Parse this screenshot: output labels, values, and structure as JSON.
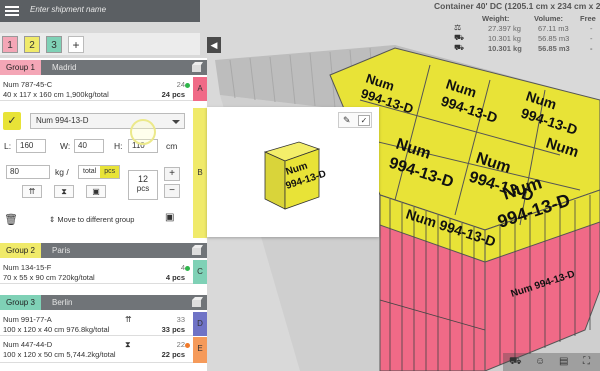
{
  "search": {
    "placeholder": "Enter shipment name"
  },
  "group_tabs": [
    "1",
    "2",
    "3"
  ],
  "add_tab": "+",
  "groups": [
    {
      "name": "Group 1",
      "city": "Madrid",
      "color": "#f4a6b6",
      "items": [
        {
          "num": "Num 787-45-C",
          "dims": "40 x 117 x 160 cm 1,900kg/total",
          "count": "24",
          "pcs": "24 pcs",
          "letter": "A",
          "letter_color": "#f06a87"
        }
      ]
    },
    {
      "name": "Group 2",
      "city": "Paris",
      "color": "#f0ea6a",
      "items": [
        {
          "num": "Num 134-15-F",
          "dims": "70 x 55 x 90 cm 720kg/total",
          "count": "4",
          "pcs": "4 pcs",
          "letter": "C",
          "letter_color": "#7fd1b6"
        }
      ]
    },
    {
      "name": "Group 3",
      "city": "Berlin",
      "color": "#7fd1b6",
      "items": [
        {
          "num": "Num 991-77-A",
          "dims": "100 x 120 x 40 cm 976.8kg/total",
          "count": "33",
          "pcs": "33 pcs",
          "letter": "D",
          "letter_color": "#6f73c6"
        },
        {
          "num": "Num 447-44-D",
          "dims": "100 x 120 x 50 cm 5,744.2kg/total",
          "count": "22",
          "pcs": "22 pcs",
          "letter": "E",
          "letter_color": "#f59a5a"
        }
      ]
    }
  ],
  "editor": {
    "selected": "Num 994-13-D",
    "length_label": "L:",
    "length": "160",
    "width_label": "W:",
    "width": "40",
    "height_label": "H:",
    "height": "110",
    "dim_unit": "cm",
    "weight": "80",
    "weight_unit": "kg /",
    "toggle_total": "total",
    "toggle_pcs": "pcs",
    "qty": "12",
    "qty_unit": "pcs",
    "plus": "+",
    "minus": "−",
    "move_label": "Move to different group",
    "letter": "B"
  },
  "preview": {
    "box_label": "Num\n994-13-D"
  },
  "container": {
    "title": "Container 40' DC (1205.1 cm x 234 cm x 2",
    "headers": [
      "Weight:",
      "Volume:",
      "Free"
    ],
    "rows": [
      [
        "27.397 kg",
        "67.11 m3",
        "-"
      ],
      [
        "10.301 kg",
        "56.85 m3",
        "-"
      ],
      [
        "10.301 kg",
        "56.85 m3",
        "-"
      ]
    ]
  },
  "scene_label": "Num\n994-13-D",
  "small_label": "787-45-C",
  "colors": {
    "yellow": "#e8e337",
    "pink": "#f06a87",
    "panel_gray": "#707478"
  }
}
